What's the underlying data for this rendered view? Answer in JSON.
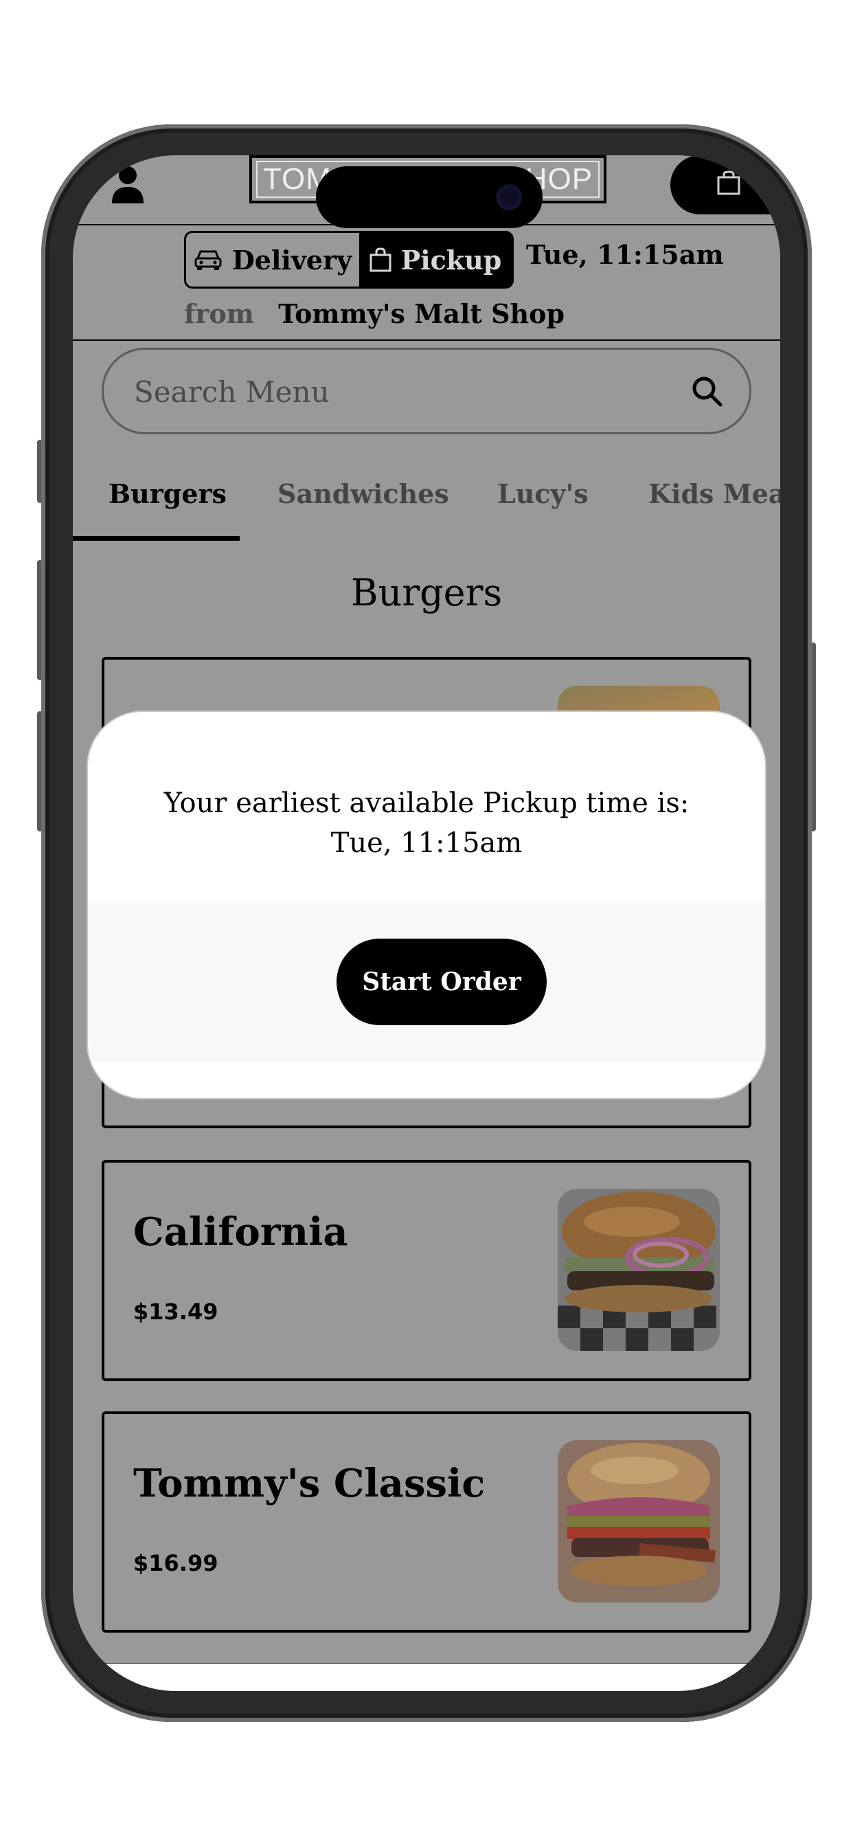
{
  "header": {
    "logo_text": "TOMMY'S MALT SHOP",
    "profile_icon": "person-icon",
    "cart_icon": "bag-icon"
  },
  "order_mode": {
    "delivery_label": "Delivery",
    "pickup_label": "Pickup",
    "selected": "Pickup",
    "time": "Tue, 11:15am",
    "from_label": "from",
    "store_name": "Tommy's Malt Shop"
  },
  "search": {
    "placeholder": "Search Menu"
  },
  "tabs": [
    {
      "label": "Burgers",
      "active": true
    },
    {
      "label": "Sandwiches",
      "active": false
    },
    {
      "label": "Lucy's",
      "active": false
    },
    {
      "label": "Kids Meals",
      "active": false
    }
  ],
  "section_title": "Burgers",
  "items": [
    {
      "name": "California",
      "price": "$13.49"
    },
    {
      "name": "Tommy's Classic",
      "price": "$16.99"
    }
  ],
  "modal": {
    "line1": "Your earliest available Pickup time is:",
    "line2": "Tue, 11:15am",
    "button_label": "Start Order"
  },
  "colors": {
    "overlay": "#999999",
    "primary": "#000000",
    "modal_bg": "#ffffff"
  }
}
